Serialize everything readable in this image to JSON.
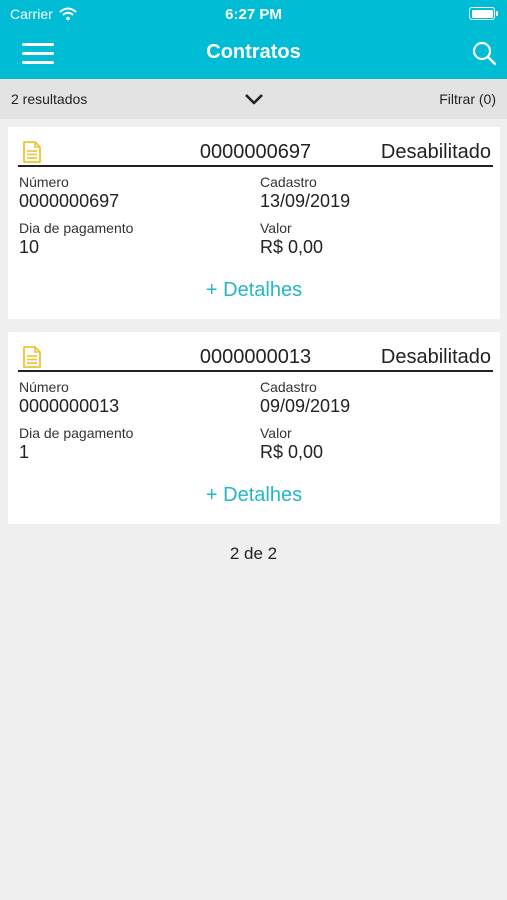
{
  "status_bar": {
    "carrier": "Carrier",
    "time": "6:27 PM"
  },
  "nav": {
    "title": "Contratos"
  },
  "filter_bar": {
    "results": "2 resultados",
    "filter_label": "Filtrar (0)"
  },
  "cards": [
    {
      "header_number": "0000000697",
      "status": "Desabilitado",
      "numero_label": "Número",
      "numero": "0000000697",
      "cadastro_label": "Cadastro",
      "cadastro": "13/09/2019",
      "dia_label": "Dia de pagamento",
      "dia": "10",
      "valor_label": "Valor",
      "valor": "R$ 0,00",
      "details_label": "+ Detalhes"
    },
    {
      "header_number": "0000000013",
      "status": "Desabilitado",
      "numero_label": "Número",
      "numero": "0000000013",
      "cadastro_label": "Cadastro",
      "cadastro": "09/09/2019",
      "dia_label": "Dia de pagamento",
      "dia": "1",
      "valor_label": "Valor",
      "valor": "R$ 0,00",
      "details_label": "+ Detalhes"
    }
  ],
  "pager": {
    "text": "2 de 2"
  },
  "colors": {
    "primary": "#00bcd4",
    "accent_link": "#26b5c9",
    "doc_icon": "#f2c230",
    "background": "#efefef"
  },
  "icons": [
    "wifi-icon",
    "battery-icon",
    "menu-icon",
    "search-icon",
    "chevron-down-icon",
    "document-icon"
  ]
}
